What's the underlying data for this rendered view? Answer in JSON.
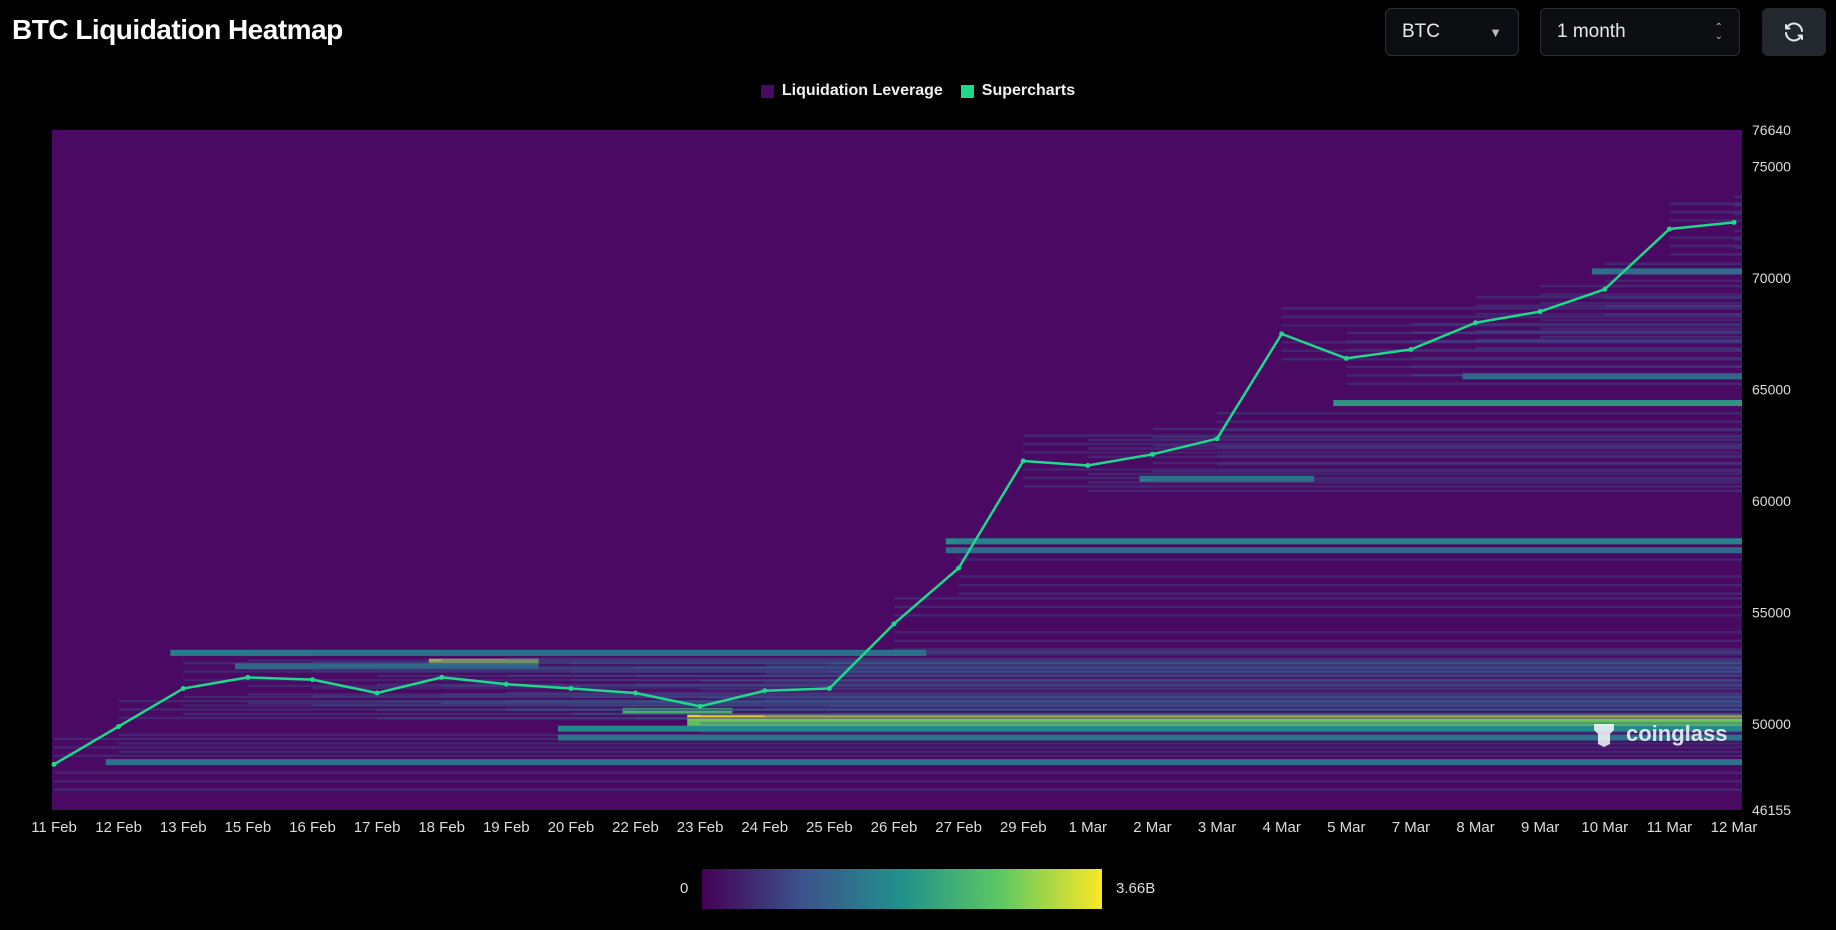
{
  "header": {
    "title": "BTC Liquidation Heatmap"
  },
  "controls": {
    "asset": "BTC",
    "range": "1 month"
  },
  "legend": [
    {
      "label": "Liquidation Leverage",
      "color": "#4a0a63"
    },
    {
      "label": "Supercharts",
      "color": "#1fd98b"
    }
  ],
  "colorbar": {
    "min_label": "0",
    "max_label": "3.66B",
    "colors": [
      "#440154",
      "#3b528b",
      "#21918c",
      "#5ec962",
      "#fde725"
    ]
  },
  "watermark": "coinglass",
  "chart_data": {
    "type": "heatmap",
    "title": "BTC Liquidation Heatmap",
    "y_axis": {
      "ticks": [
        76640,
        75000,
        70000,
        65000,
        60000,
        55000,
        50000,
        46155
      ],
      "range": [
        46155,
        76640
      ]
    },
    "x_axis": {
      "ticks": [
        "11 Feb",
        "12 Feb",
        "13 Feb",
        "15 Feb",
        "16 Feb",
        "17 Feb",
        "18 Feb",
        "19 Feb",
        "20 Feb",
        "22 Feb",
        "23 Feb",
        "24 Feb",
        "25 Feb",
        "26 Feb",
        "27 Feb",
        "29 Feb",
        "1 Mar",
        "2 Mar",
        "3 Mar",
        "4 Mar",
        "5 Mar",
        "7 Mar",
        "8 Mar",
        "9 Mar",
        "10 Mar",
        "11 Mar",
        "12 Mar"
      ]
    },
    "intensity_range": [
      "0",
      "3.66B"
    ],
    "price_path": [
      {
        "x": "11 Feb",
        "price": 48200
      },
      {
        "x": "12 Feb",
        "price": 49900
      },
      {
        "x": "13 Feb",
        "price": 51600
      },
      {
        "x": "15 Feb",
        "price": 52100
      },
      {
        "x": "16 Feb",
        "price": 52000
      },
      {
        "x": "17 Feb",
        "price": 51400
      },
      {
        "x": "18 Feb",
        "price": 52100
      },
      {
        "x": "19 Feb",
        "price": 51800
      },
      {
        "x": "20 Feb",
        "price": 51600
      },
      {
        "x": "22 Feb",
        "price": 51400
      },
      {
        "x": "23 Feb",
        "price": 50800
      },
      {
        "x": "24 Feb",
        "price": 51500
      },
      {
        "x": "25 Feb",
        "price": 51600
      },
      {
        "x": "26 Feb",
        "price": 54500
      },
      {
        "x": "27 Feb",
        "price": 57000
      },
      {
        "x": "29 Feb",
        "price": 61800
      },
      {
        "x": "1 Mar",
        "price": 61600
      },
      {
        "x": "2 Mar",
        "price": 62100
      },
      {
        "x": "3 Mar",
        "price": 62800
      },
      {
        "x": "4 Mar",
        "price": 67500
      },
      {
        "x": "5 Mar",
        "price": 66400
      },
      {
        "x": "7 Mar",
        "price": 66800
      },
      {
        "x": "8 Mar",
        "price": 68000
      },
      {
        "x": "9 Mar",
        "price": 68500
      },
      {
        "x": "10 Mar",
        "price": 69500
      },
      {
        "x": "11 Mar",
        "price": 72200
      },
      {
        "x": "12 Mar",
        "price": 72500
      }
    ],
    "liquidation_bands": [
      {
        "price": 50300,
        "from": "23 Feb",
        "to": "12 Mar",
        "intensity": 1.0
      },
      {
        "price": 50050,
        "from": "23 Feb",
        "to": "12 Mar",
        "intensity": 0.75
      },
      {
        "price": 49800,
        "from": "20 Feb",
        "to": "12 Mar",
        "intensity": 0.5
      },
      {
        "price": 49400,
        "from": "20 Feb",
        "to": "12 Mar",
        "intensity": 0.42
      },
      {
        "price": 48300,
        "from": "12 Feb",
        "to": "12 Mar",
        "intensity": 0.4
      },
      {
        "price": 52800,
        "from": "18 Feb",
        "to": "19 Feb",
        "intensity": 0.92
      },
      {
        "price": 53200,
        "from": "13 Feb",
        "to": "26 Feb",
        "intensity": 0.45
      },
      {
        "price": 52600,
        "from": "15 Feb",
        "to": "19 Feb",
        "intensity": 0.35
      },
      {
        "price": 50600,
        "from": "22 Feb",
        "to": "23 Feb",
        "intensity": 0.7
      },
      {
        "price": 58200,
        "from": "27 Feb",
        "to": "12 Mar",
        "intensity": 0.5
      },
      {
        "price": 57800,
        "from": "27 Feb",
        "to": "12 Mar",
        "intensity": 0.38
      },
      {
        "price": 61000,
        "from": "2 Mar",
        "to": "4 Mar",
        "intensity": 0.45
      },
      {
        "price": 64400,
        "from": "5 Mar",
        "to": "12 Mar",
        "intensity": 0.55
      },
      {
        "price": 65600,
        "from": "8 Mar",
        "to": "12 Mar",
        "intensity": 0.38
      },
      {
        "price": 70300,
        "from": "10 Mar",
        "to": "12 Mar",
        "intensity": 0.4
      }
    ]
  }
}
